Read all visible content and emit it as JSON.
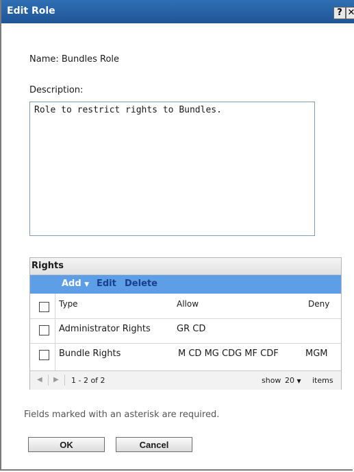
{
  "dialog": {
    "title": "Edit Role",
    "help_label": "?",
    "close_label": "✕"
  },
  "name_line": "Name: Bundles Role",
  "description": {
    "label": "Description:",
    "value": "Role to restrict rights to Bundles."
  },
  "rights": {
    "title": "Rights",
    "toolbar": {
      "add": "Add",
      "edit": "Edit",
      "delete": "Delete"
    },
    "columns": {
      "type": "Type",
      "allow": "Allow",
      "deny": "Deny"
    },
    "rows": [
      {
        "type": "Administrator Rights",
        "allow": "GR CD",
        "deny": ""
      },
      {
        "type": "Bundle Rights",
        "allow": "M CD MG CDG MF CDF",
        "deny": "MGM"
      }
    ],
    "pager": {
      "range": "1 - 2 of 2",
      "show": "show",
      "count": "20",
      "items": "items"
    }
  },
  "footer_note": "Fields marked with an asterisk are required.",
  "buttons": {
    "ok": "OK",
    "cancel": "Cancel"
  },
  "colors": {
    "title_bar": "#2f6fb4",
    "toolbar": "#5d9ee6"
  }
}
